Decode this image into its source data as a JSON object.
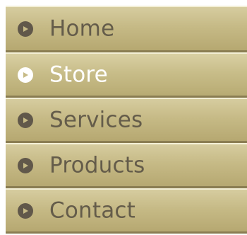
{
  "menu": {
    "items": [
      {
        "label": "Home",
        "icon": "play-circle-icon",
        "active": false
      },
      {
        "label": "Store",
        "icon": "play-circle-icon",
        "active": true
      },
      {
        "label": "Services",
        "icon": "play-circle-icon",
        "active": false
      },
      {
        "label": "Products",
        "icon": "play-circle-icon",
        "active": false
      },
      {
        "label": "Contact",
        "icon": "play-circle-icon",
        "active": false
      }
    ]
  },
  "colors": {
    "item_background": "#c6ba86",
    "label_text": "#645c4a",
    "active_label_text": "#ffffff",
    "bullet": "#61584a",
    "active_bullet": "#ffffff"
  }
}
